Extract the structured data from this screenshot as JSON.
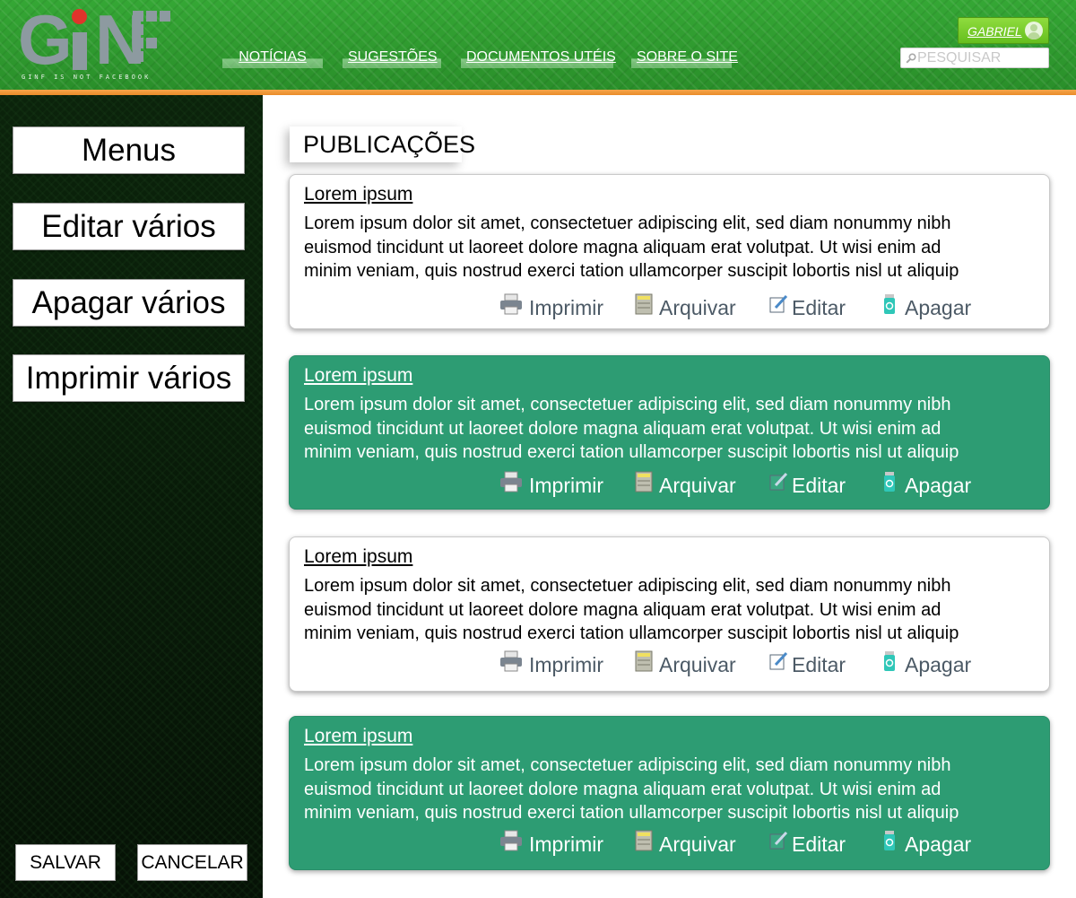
{
  "brand": {
    "logo_text": "GINF",
    "tagline": "GINF IS NOT FACEBOOK",
    "colors": {
      "header_green": "#2f9a2f",
      "accent_orange": "#e98c2a",
      "logo_grey": "#8d9aa0",
      "logo_dot_red": "#e0342b",
      "card_green": "#2d9c73"
    }
  },
  "header": {
    "nav": [
      {
        "label": "NOTÍCIAS"
      },
      {
        "label": "SUGESTÕES"
      },
      {
        "label": "DOCUMENTOS UTÉIS"
      },
      {
        "label": "SOBRE O SITE"
      }
    ],
    "user": {
      "name": "GABRIEL",
      "icon": "user-avatar-icon"
    },
    "search": {
      "placeholder": "PESQUISAR",
      "value": "",
      "icon": "search-icon"
    }
  },
  "sidebar": {
    "buttons": [
      {
        "label": "Menus"
      },
      {
        "label": "Editar vários"
      },
      {
        "label": "Apagar vários"
      },
      {
        "label": "Imprimir vários"
      }
    ],
    "save_label": "SALVAR",
    "cancel_label": "CANCELAR"
  },
  "main": {
    "section_title": "PUBLICAÇÕES",
    "publications": [
      {
        "title": "Lorem ipsum",
        "style": "white",
        "lines": [
          "Lorem ipsum dolor sit amet, consectetuer adipiscing elit, sed diam nonummy nibh",
          "euismod tincidunt ut laoreet dolore magna aliquam erat volutpat. Ut wisi enim ad",
          "minim veniam, quis nostrud exerci tation ullamcorper suscipit lobortis nisl ut aliquip"
        ]
      },
      {
        "title": "Lorem ipsum",
        "style": "green",
        "lines": [
          "Lorem ipsum dolor sit amet, consectetuer adipiscing elit, sed diam nonummy nibh",
          "euismod tincidunt ut laoreet dolore magna aliquam erat volutpat. Ut wisi enim ad",
          "minim veniam, quis nostrud exerci tation ullamcorper suscipit lobortis nisl ut aliquip"
        ]
      },
      {
        "title": "Lorem ipsum",
        "style": "white",
        "lines": [
          "Lorem ipsum dolor sit amet, consectetuer adipiscing elit, sed diam nonummy nibh",
          "euismod tincidunt ut laoreet dolore magna aliquam erat volutpat. Ut wisi enim ad",
          "minim veniam, quis nostrud exerci tation ullamcorper suscipit lobortis nisl ut aliquip"
        ]
      },
      {
        "title": "Lorem ipsum",
        "style": "green",
        "lines": [
          "Lorem ipsum dolor sit amet, consectetuer adipiscing elit, sed diam nonummy nibh",
          "euismod tincidunt ut laoreet dolore magna aliquam erat volutpat. Ut wisi enim ad",
          "minim veniam, quis nostrud exerci tation ullamcorper suscipit lobortis nisl ut aliquip"
        ]
      }
    ],
    "actions": [
      {
        "label": "Imprimir",
        "icon": "printer-icon"
      },
      {
        "label": "Arquivar",
        "icon": "archive-cabinet-icon"
      },
      {
        "label": "Editar",
        "icon": "edit-pencil-icon"
      },
      {
        "label": "Apagar",
        "icon": "recycle-bin-icon"
      }
    ]
  }
}
